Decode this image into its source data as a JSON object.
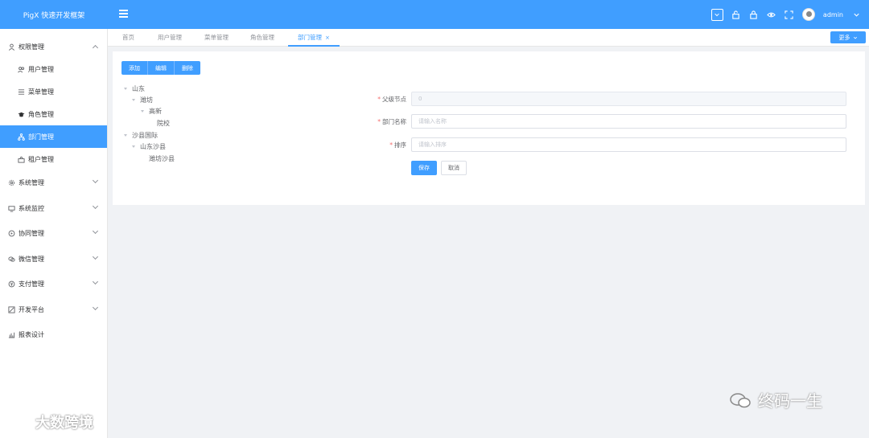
{
  "app": {
    "title": "PigX 快速开发框架"
  },
  "header": {
    "user": "admin"
  },
  "sidebar": {
    "items": [
      {
        "label": "权限管理",
        "icon": "user-icon",
        "expanded": true
      },
      {
        "label": "用户管理",
        "icon": "users-icon"
      },
      {
        "label": "菜单管理",
        "icon": "list-icon"
      },
      {
        "label": "角色管理",
        "icon": "graduation-cap-icon"
      },
      {
        "label": "部门管理",
        "icon": "org-tree-icon",
        "active": true
      },
      {
        "label": "租户管理",
        "icon": "bag-icon"
      },
      {
        "label": "系统管理",
        "icon": "gear-icon"
      },
      {
        "label": "系统监控",
        "icon": "monitor-icon"
      },
      {
        "label": "协同管理",
        "icon": "collab-icon"
      },
      {
        "label": "微信管理",
        "icon": "wechat-icon"
      },
      {
        "label": "支付管理",
        "icon": "yen-icon"
      },
      {
        "label": "开发平台",
        "icon": "dev-icon"
      },
      {
        "label": "报表设计",
        "icon": "chart-icon"
      }
    ]
  },
  "tabs": {
    "items": [
      "首页",
      "用户管理",
      "菜单管理",
      "角色管理",
      "部门管理"
    ],
    "close": "×",
    "more": "更多"
  },
  "toolbar": {
    "add": "添加",
    "edit": "编辑",
    "delete": "删除"
  },
  "tree": {
    "n1": "山东",
    "n2": "潍坊",
    "n3": "高新",
    "n4": "院校",
    "n5": "沙县国际",
    "n6": "山东沙县",
    "n7": "潍坊沙县"
  },
  "form": {
    "required_mark": "*",
    "parent": {
      "label": "父级节点",
      "value": "0"
    },
    "name": {
      "label": "部门名称",
      "placeholder": "请输入名称"
    },
    "sort": {
      "label": "排序",
      "placeholder": "请输入排序"
    },
    "save": "保存",
    "cancel": "取消"
  },
  "watermark": {
    "left": "大数跨境",
    "right": "终码一生"
  }
}
